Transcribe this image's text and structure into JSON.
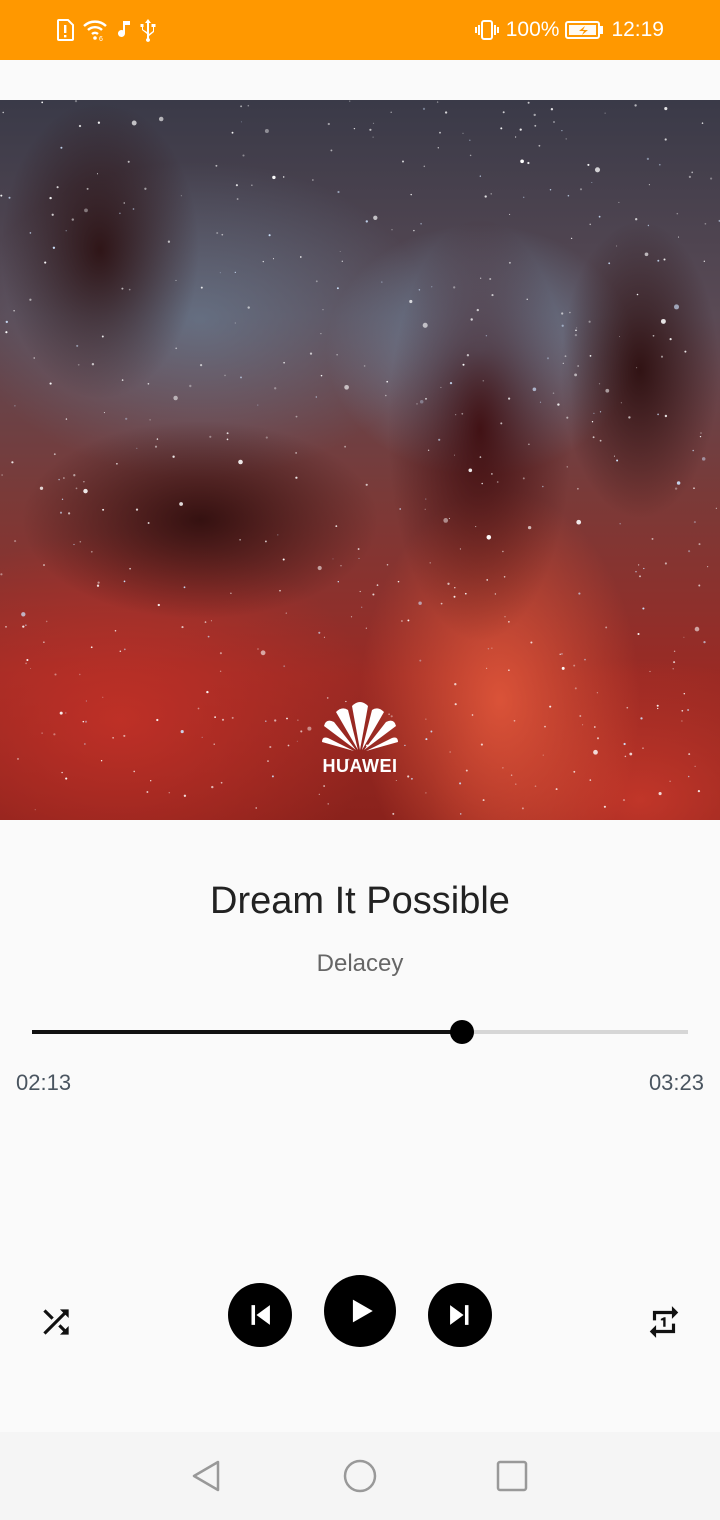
{
  "status_bar": {
    "battery": "100%",
    "time": "12:19",
    "left_icons": [
      "alert-sim-icon",
      "wifi-icon",
      "music-note-icon",
      "usb-icon"
    ],
    "right_icons": [
      "vibrate-icon",
      "battery-charging-icon"
    ]
  },
  "album_art": {
    "brand": "HUAWEI"
  },
  "track": {
    "title": "Dream It Possible",
    "artist": "Delacey",
    "elapsed": "02:13",
    "duration": "03:23",
    "progress": 0.656
  },
  "controls": {
    "shuffle": "shuffle-icon",
    "previous": "skip-previous-icon",
    "play": "play-icon",
    "next": "skip-next-icon",
    "repeat": "repeat-one-icon"
  },
  "colors": {
    "status_bar": "#ff9800",
    "accent": "#000000",
    "background": "#fafafa"
  }
}
